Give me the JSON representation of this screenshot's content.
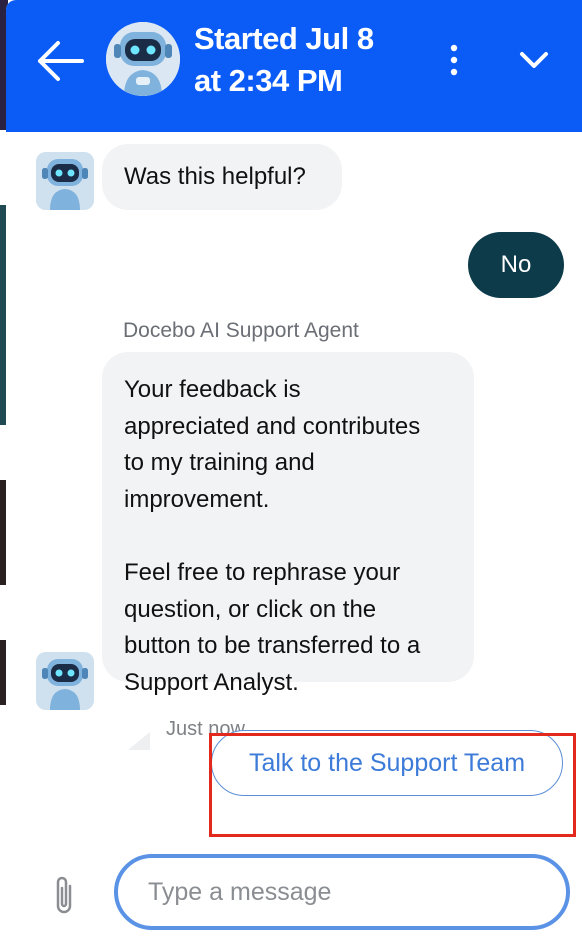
{
  "header": {
    "title_line1": "Started Jul 8",
    "title_line2": "at 2:34 PM",
    "back_icon": "arrow-left-icon",
    "more_icon": "kebab-menu-icon",
    "collapse_icon": "chevron-down-icon",
    "avatar": "robot-avatar",
    "background_color": "#0b5cf6"
  },
  "conversation": {
    "messages": [
      {
        "from": "bot",
        "text": "Was this helpful?"
      },
      {
        "from": "user",
        "text": "No"
      },
      {
        "from": "bot",
        "sender": "Docebo AI Support Agent",
        "paragraphs": [
          "Your feedback is\nappreciated and contributes\nto my training and\nimprovement.",
          "Feel free to rephrase your\nquestion, or click on the\nbutton to be transferred to a\nSupport Analyst."
        ],
        "timestamp": "Just now"
      }
    ],
    "action_button_label": "Talk to the Support Team"
  },
  "composer": {
    "placeholder": "Type a message",
    "attach_icon": "paperclip-icon"
  },
  "colors": {
    "user_bubble": "#0d3b4a",
    "bot_bubble": "#f2f3f5",
    "highlight": "#e2291c",
    "input_border": "#5a92e6"
  }
}
